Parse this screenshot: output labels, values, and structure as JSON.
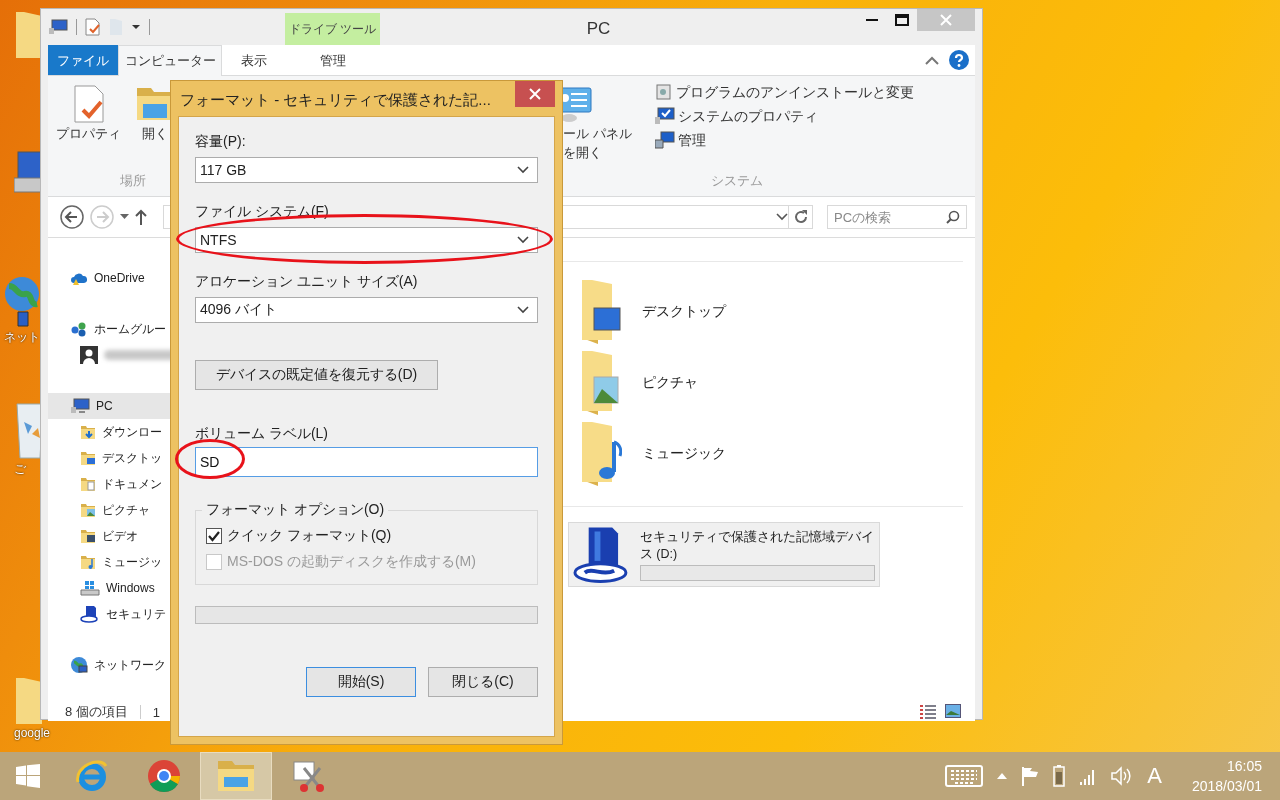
{
  "desktop_icons": [
    {
      "kind": "folder"
    },
    {
      "kind": "computer"
    },
    {
      "kind": "network",
      "label": "ネット"
    },
    {
      "kind": "recycle-bin",
      "label": "ご"
    },
    {
      "kind": "folder",
      "label": "google"
    }
  ],
  "explorer": {
    "title": "PC",
    "tool_tab_group": "ドライブ ツール",
    "tabs": [
      {
        "label": "ファイル",
        "kind": "menu",
        "selected": false
      },
      {
        "label": "コンピューター",
        "kind": "tab",
        "selected": true
      },
      {
        "label": "表示",
        "kind": "tab",
        "selected": false
      },
      {
        "label": "管理",
        "kind": "tab",
        "selected": false
      }
    ],
    "ribbon": {
      "groups": [
        {
          "label": "場所",
          "buttons": [
            {
              "kind": "properties",
              "label": "プロパティ"
            },
            {
              "kind": "open",
              "label": "開く"
            }
          ]
        },
        {
          "label": "システム",
          "buttons": [
            {
              "kind": "control-panel",
              "label": "ール パネルを開く"
            }
          ],
          "links": [
            {
              "kind": "uninstall",
              "label": "プログラムのアンインストールと変更"
            },
            {
              "kind": "system-properties",
              "label": "システムのプロパティ"
            },
            {
              "kind": "manage",
              "label": "管理"
            }
          ]
        }
      ]
    },
    "search": {
      "placeholder": "PCの検索"
    },
    "nav_pane": [
      {
        "kind": "cloud",
        "label": "OneDrive",
        "selected": false
      },
      {
        "kind": "homegroup",
        "label": "ホームグルー",
        "selected": false,
        "children": [
          {
            "kind": "user",
            "selected": false
          }
        ]
      },
      {
        "kind": "pc",
        "label": "PC",
        "selected": true,
        "children": [
          {
            "kind": "downloads",
            "label": "ダウンロー",
            "selected": false
          },
          {
            "kind": "desktop",
            "label": "デスクトッ",
            "selected": false
          },
          {
            "kind": "documents",
            "label": "ドキュメン",
            "selected": false
          },
          {
            "kind": "pictures",
            "label": "ピクチャ",
            "selected": false
          },
          {
            "kind": "videos",
            "label": "ビデオ",
            "selected": false
          },
          {
            "kind": "music",
            "label": "ミュージッ",
            "selected": false
          },
          {
            "kind": "drive",
            "label": "Windows",
            "selected": false
          },
          {
            "kind": "sd",
            "label": "セキュリテ",
            "selected": false
          }
        ]
      },
      {
        "kind": "network",
        "label": "ネットワーク",
        "selected": false
      }
    ],
    "folders": [
      {
        "kind": "desktop",
        "label": "デスクトップ"
      },
      {
        "kind": "pictures",
        "label": "ピクチャ"
      },
      {
        "kind": "music",
        "label": "ミュージック"
      }
    ],
    "devices": [
      {
        "kind": "sd",
        "label": "セキュリティで保護された記憶域デバイス (D:)"
      }
    ],
    "status_bar": {
      "item_count": "8 個の項目",
      "column_2": "1"
    }
  },
  "format_dialog": {
    "title": "フォーマット - セキュリティで保護された記...",
    "fields": [
      {
        "kind": "select",
        "label": "容量(P):",
        "value": "117 GB",
        "highlighted": false
      },
      {
        "kind": "select",
        "label": "ファイル システム(F)",
        "value": "NTFS",
        "highlighted": true
      },
      {
        "kind": "select",
        "label": "アロケーション ユニット サイズ(A)",
        "value": "4096 バイト",
        "highlighted": false
      },
      {
        "kind": "button",
        "label": "デバイスの既定値を復元する(D)"
      },
      {
        "kind": "text",
        "label": "ボリューム ラベル(L)",
        "value": "SD",
        "highlighted": true
      }
    ],
    "options": {
      "title": "フォーマット オプション(O)",
      "items": [
        {
          "label": "クイック フォーマット(Q)",
          "checked": true,
          "disabled": false
        },
        {
          "label": "MS-DOS の起動ディスクを作成する(M)",
          "checked": false,
          "disabled": true
        }
      ]
    },
    "progress": {
      "level": 0
    },
    "buttons": [
      {
        "label": "開始(S)",
        "default": true
      },
      {
        "label": "閉じる(C)",
        "default": false
      }
    ]
  },
  "taskbar": {
    "apps": [
      {
        "kind": "start",
        "selected": false
      },
      {
        "kind": "ie",
        "selected": false
      },
      {
        "kind": "chrome",
        "selected": false
      },
      {
        "kind": "explorer",
        "selected": true
      },
      {
        "kind": "snipping",
        "selected": false
      }
    ],
    "tray": {
      "ime": "A",
      "time": "16:05",
      "date": "2018/03/01"
    }
  }
}
